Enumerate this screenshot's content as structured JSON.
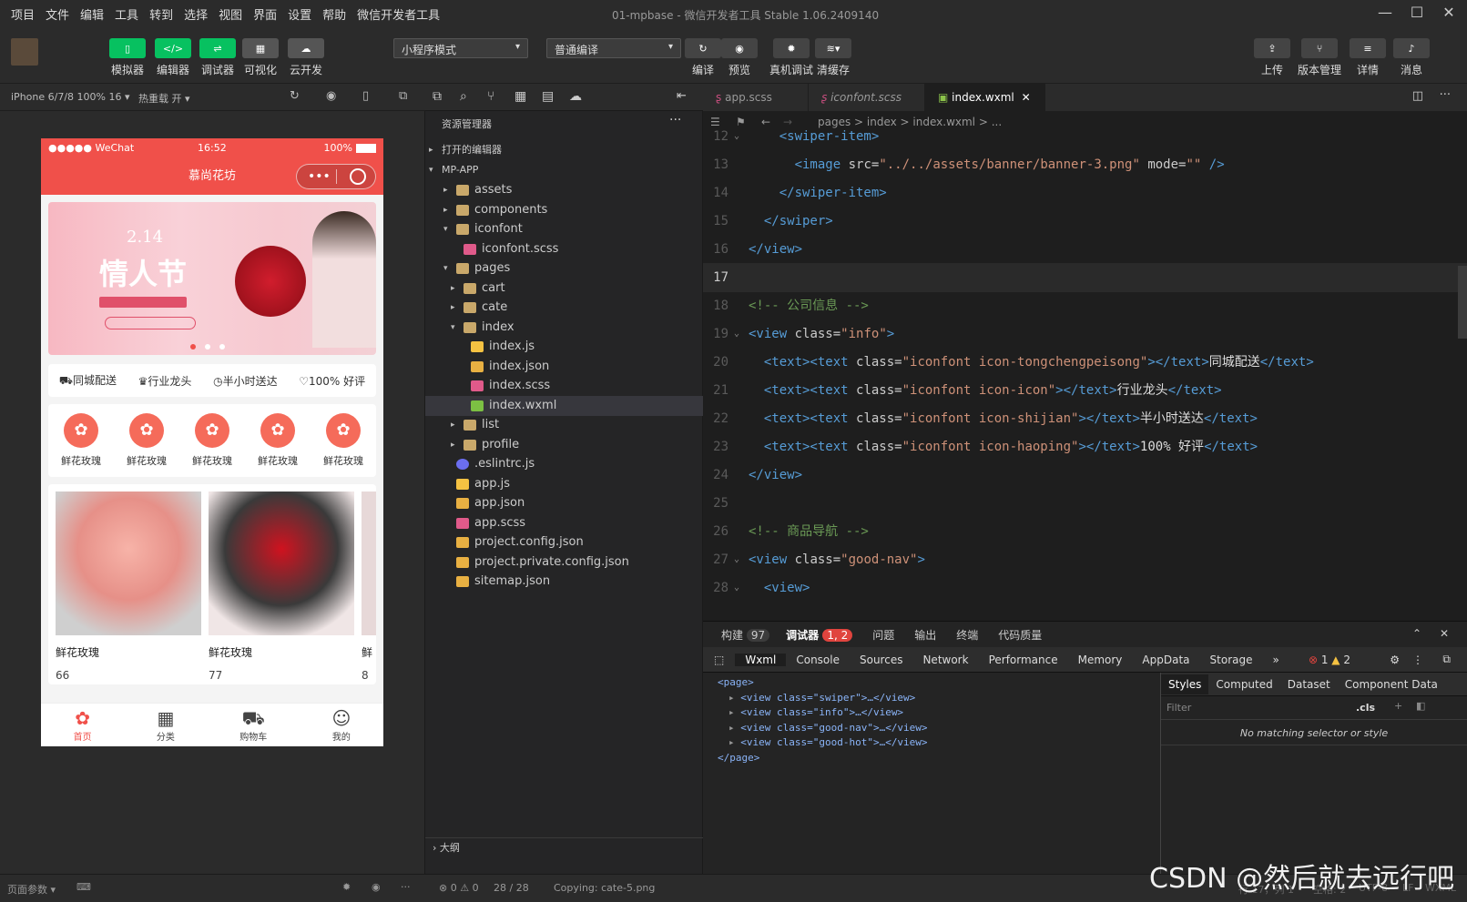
{
  "menu": [
    "项目",
    "文件",
    "编辑",
    "工具",
    "转到",
    "选择",
    "视图",
    "界面",
    "设置",
    "帮助",
    "微信开发者工具"
  ],
  "window_title": "01-mpbase - 微信开发者工具 Stable 1.06.2409140",
  "toolbar": {
    "simulator": "模拟器",
    "editor": "编辑器",
    "debugger": "调试器",
    "visual": "可视化",
    "cloud": "云开发",
    "mode": "小程序模式",
    "compile_mode": "普通编译",
    "compile": "编译",
    "preview": "预览",
    "real_debug": "真机调试",
    "clear_cache": "清缓存",
    "upload": "上传",
    "version": "版本管理",
    "details": "详情",
    "message": "消息"
  },
  "simbar": {
    "device": "iPhone 6/7/8 100% 16",
    "hotreload": "热重载 开"
  },
  "phone": {
    "carrier": "●●●●● WeChat",
    "time": "16:52",
    "battery": "100%",
    "title": "慕尚花坊",
    "banner_date": "2.14",
    "banner_title": "情人节",
    "info": [
      "同城配送",
      "行业龙头",
      "半小时送达",
      "100% 好评"
    ],
    "nav": [
      "鲜花玫瑰",
      "鲜花玫瑰",
      "鲜花玫瑰",
      "鲜花玫瑰",
      "鲜花玫瑰"
    ],
    "hot": [
      {
        "name": "鲜花玫瑰",
        "price": "66"
      },
      {
        "name": "鲜花玫瑰",
        "price": "77"
      },
      {
        "name": "鲜",
        "price": "8"
      }
    ],
    "tabs": [
      "首页",
      "分类",
      "购物车",
      "我的"
    ]
  },
  "explorer": {
    "title": "资源管理器",
    "open_editors": "打开的编辑器",
    "project": "MP-APP",
    "outline": "大纲",
    "items": [
      {
        "name": "assets",
        "type": "folder",
        "depth": 1,
        "open": false
      },
      {
        "name": "components",
        "type": "folder",
        "depth": 1,
        "open": false
      },
      {
        "name": "iconfont",
        "type": "folder",
        "depth": 1,
        "open": true
      },
      {
        "name": "iconfont.scss",
        "type": "scss",
        "depth": 2
      },
      {
        "name": "pages",
        "type": "folder",
        "depth": 1,
        "open": true
      },
      {
        "name": "cart",
        "type": "folder",
        "depth": 2,
        "open": false
      },
      {
        "name": "cate",
        "type": "folder",
        "depth": 2,
        "open": false
      },
      {
        "name": "index",
        "type": "folder",
        "depth": 2,
        "open": true
      },
      {
        "name": "index.js",
        "type": "js",
        "depth": 3
      },
      {
        "name": "index.json",
        "type": "json",
        "depth": 3
      },
      {
        "name": "index.scss",
        "type": "scss",
        "depth": 3
      },
      {
        "name": "index.wxml",
        "type": "wxml",
        "depth": 3,
        "selected": true
      },
      {
        "name": "list",
        "type": "folder",
        "depth": 2,
        "open": false
      },
      {
        "name": "profile",
        "type": "folder",
        "depth": 2,
        "open": false
      },
      {
        "name": ".eslintrc.js",
        "type": "eslint",
        "depth": 1
      },
      {
        "name": "app.js",
        "type": "js",
        "depth": 1
      },
      {
        "name": "app.json",
        "type": "json",
        "depth": 1
      },
      {
        "name": "app.scss",
        "type": "scss",
        "depth": 1
      },
      {
        "name": "project.config.json",
        "type": "json",
        "depth": 1
      },
      {
        "name": "project.private.config.json",
        "type": "json",
        "depth": 1
      },
      {
        "name": "sitemap.json",
        "type": "json",
        "depth": 1
      }
    ]
  },
  "editor": {
    "tabs": [
      "app.scss",
      "iconfont.scss",
      "index.wxml"
    ],
    "breadcrumb": "pages > index > index.wxml > ...",
    "lines": [
      {
        "n": "12",
        "html": "    <span class='tg'>&lt;swiper-item&gt;</span>"
      },
      {
        "n": "13",
        "html": "      <span class='tg'>&lt;image</span> <span class='at'>src=</span><span class='st'>\"../../assets/banner/banner-3.png\"</span> <span class='at'>mode=</span><span class='st'>\"\"</span> <span class='tg'>/&gt;</span>"
      },
      {
        "n": "14",
        "html": "    <span class='tg'>&lt;/swiper-item&gt;</span>"
      },
      {
        "n": "15",
        "html": "  <span class='tg'>&lt;/swiper&gt;</span>"
      },
      {
        "n": "16",
        "html": "<span class='tg'>&lt;/view&gt;</span>"
      },
      {
        "n": "17",
        "html": ""
      },
      {
        "n": "18",
        "html": "<span class='cm'>&lt;!-- 公司信息 --&gt;</span>"
      },
      {
        "n": "19",
        "html": "<span class='tg'>&lt;view</span> <span class='at'>class=</span><span class='st'>\"info\"</span><span class='tg'>&gt;</span>"
      },
      {
        "n": "20",
        "html": "  <span class='tg'>&lt;text&gt;&lt;text</span> <span class='at'>class=</span><span class='st'>\"iconfont icon-tongchengpeisong\"</span><span class='tg'>&gt;&lt;/text&gt;</span><span class='tx'>同城配送</span><span class='tg'>&lt;/text&gt;</span>"
      },
      {
        "n": "21",
        "html": "  <span class='tg'>&lt;text&gt;&lt;text</span> <span class='at'>class=</span><span class='st'>\"iconfont icon-icon\"</span><span class='tg'>&gt;&lt;/text&gt;</span><span class='tx'>行业龙头</span><span class='tg'>&lt;/text&gt;</span>"
      },
      {
        "n": "22",
        "html": "  <span class='tg'>&lt;text&gt;&lt;text</span> <span class='at'>class=</span><span class='st'>\"iconfont icon-shijian\"</span><span class='tg'>&gt;&lt;/text&gt;</span><span class='tx'>半小时送达</span><span class='tg'>&lt;/text&gt;</span>"
      },
      {
        "n": "23",
        "html": "  <span class='tg'>&lt;text&gt;&lt;text</span> <span class='at'>class=</span><span class='st'>\"iconfont icon-haoping\"</span><span class='tg'>&gt;&lt;/text&gt;</span><span class='tx'>100% 好评</span><span class='tg'>&lt;/text&gt;</span>"
      },
      {
        "n": "24",
        "html": "<span class='tg'>&lt;/view&gt;</span>"
      },
      {
        "n": "25",
        "html": ""
      },
      {
        "n": "26",
        "html": "<span class='cm'>&lt;!-- 商品导航 --&gt;</span>"
      },
      {
        "n": "27",
        "html": "<span class='tg'>&lt;view</span> <span class='at'>class=</span><span class='st'>\"good-nav\"</span><span class='tg'>&gt;</span>"
      },
      {
        "n": "28",
        "html": "  <span class='tg'>&lt;view&gt;</span>"
      }
    ]
  },
  "devtools": {
    "panel_tabs": [
      "构建",
      "调试器",
      "问题",
      "输出",
      "终端",
      "代码质量"
    ],
    "build_count": "97",
    "debug_badge": "1, 2",
    "tabs": [
      "Wxml",
      "Console",
      "Sources",
      "Network",
      "Performance",
      "Memory",
      "AppData",
      "Storage"
    ],
    "errors": "1",
    "warnings": "2",
    "wxml": [
      "<page>",
      "<view class=\"swiper\">…</view>",
      "<view class=\"info\">…</view>",
      "<view class=\"good-nav\">…</view>",
      "<view class=\"good-hot\">…</view>",
      "</page>"
    ],
    "styles_tabs": [
      "Styles",
      "Computed",
      "Dataset",
      "Component Data"
    ],
    "filter": "Filter",
    "cls": ".cls",
    "no_match": "No matching selector or style"
  },
  "statusbar": {
    "page_params": "页面参数",
    "problems": "⊗ 0 ⚠ 0",
    "position": "28 / 28",
    "copying": "Copying: cate-5.png",
    "cursor": "行 17，列 1",
    "spaces": "空格: 2",
    "encoding": "UTF-8",
    "eol": "LF",
    "lang": "WXML"
  },
  "watermark": "CSDN @然后就去远行吧"
}
